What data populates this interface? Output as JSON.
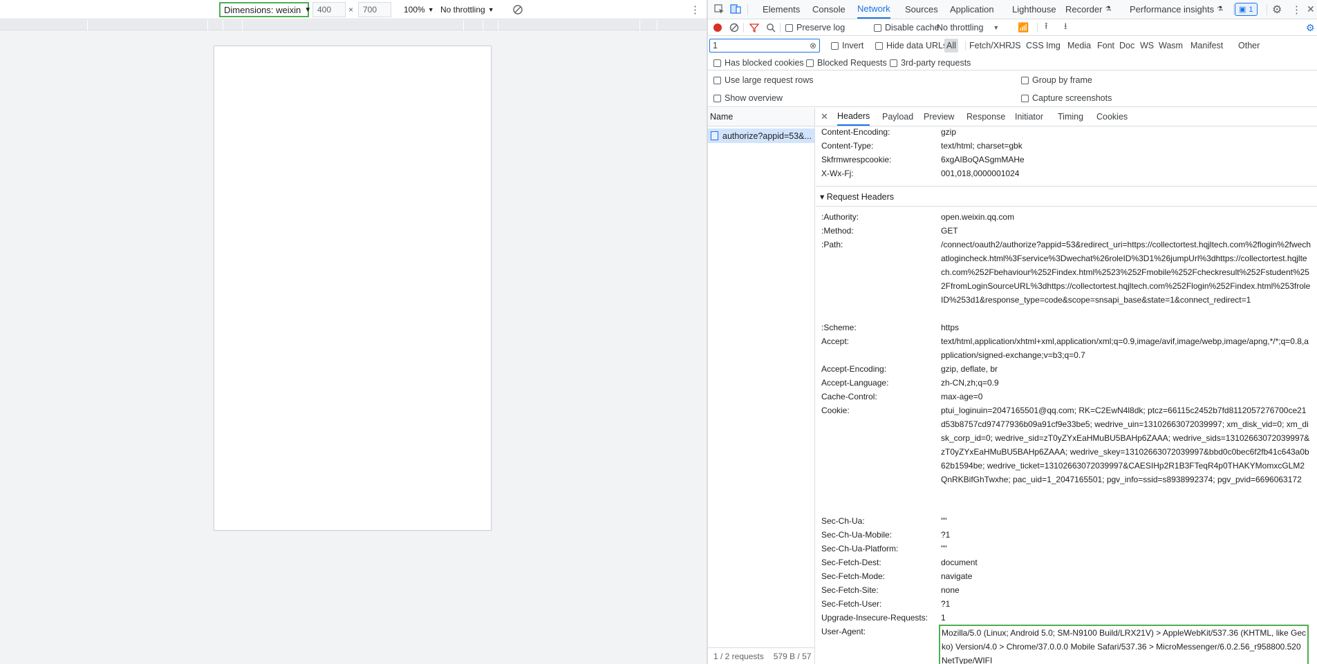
{
  "device_toolbar": {
    "dimensions_label": "Dimensions: weixin",
    "width": "400",
    "times": "×",
    "height": "700",
    "zoom": "100%",
    "throttling": "No throttling"
  },
  "devtools": {
    "tabs": [
      "Elements",
      "Console",
      "Network",
      "Sources",
      "Application",
      "Lighthouse",
      "Recorder",
      "Performance insights"
    ],
    "active_tab": "Network",
    "issues_badge": "1",
    "network_toolbar": {
      "preserve_log": "Preserve log",
      "disable_cache": "Disable cache",
      "throttling": "No throttling"
    },
    "filter": {
      "value": "1",
      "invert": "Invert",
      "hide_data_urls": "Hide data URLs",
      "types": [
        "All",
        "Fetch/XHR",
        "JS",
        "CSS",
        "Img",
        "Media",
        "Font",
        "Doc",
        "WS",
        "Wasm",
        "Manifest",
        "Other"
      ],
      "has_blocked_cookies": "Has blocked cookies",
      "blocked_requests": "Blocked Requests",
      "third_party": "3rd-party requests"
    },
    "settings": {
      "large_rows": "Use large request rows",
      "show_overview": "Show overview",
      "group_by_frame": "Group by frame",
      "capture_screenshots": "Capture screenshots"
    },
    "requests": {
      "name_header": "Name",
      "rows": [
        "authorize?appid=53&..."
      ],
      "status_requests": "1 / 2 requests",
      "status_size": "579 B / 57"
    },
    "detail_tabs": [
      "Headers",
      "Payload",
      "Preview",
      "Response",
      "Initiator",
      "Timing",
      "Cookies"
    ],
    "response_headers": [
      {
        "name": "Content-Encoding:",
        "value": "gzip"
      },
      {
        "name": "Content-Type:",
        "value": "text/html; charset=gbk"
      },
      {
        "name": "Skfrmwrespcookie:",
        "value": "6xgAIBoQASgmMAHe"
      },
      {
        "name": "X-Wx-Fj:",
        "value": "001,018,0000001024"
      }
    ],
    "request_headers_title": "▾ Request Headers",
    "request_headers": [
      {
        "name": ":Authority:",
        "value": "open.weixin.qq.com"
      },
      {
        "name": ":Method:",
        "value": "GET"
      },
      {
        "name": ":Path:",
        "value": "/connect/oauth2/authorize?appid=53&redirect_uri=https://collectortest.hqjltech.com%2flogin%2fwechatlogincheck.html%3Fservice%3Dwechat%26roleID%3D1%26jumpUrl%3dhttps://collectortest.hqjltech.com%252Fbehaviour%252Findex.html%2523%252Fmobile%252Fcheckresult%252Fstudent%252FfromLoginSourceURL%3dhttps://collectortest.hqjltech.com%252Flogin%252Findex.html%253froleID%253d1&response_type=code&scope=snsapi_base&state=1&connect_redirect=1"
      },
      {
        "name": ":Scheme:",
        "value": "https"
      },
      {
        "name": "Accept:",
        "value": "text/html,application/xhtml+xml,application/xml;q=0.9,image/avif,image/webp,image/apng,*/*;q=0.8,application/signed-exchange;v=b3;q=0.7"
      },
      {
        "name": "Accept-Encoding:",
        "value": "gzip, deflate, br"
      },
      {
        "name": "Accept-Language:",
        "value": "zh-CN,zh;q=0.9"
      },
      {
        "name": "Cache-Control:",
        "value": "max-age=0"
      },
      {
        "name": "Cookie:",
        "value": "ptui_loginuin=2047165501@qq.com; RK=C2EwN4l8dk; ptcz=66115c2452b7fd8112057276700ce21d53b8757cd97477936b09a91cf9e33be5; wedrive_uin=13102663072039997; xm_disk_vid=0; xm_disk_corp_id=0; wedrive_sid=zT0yZYxEaHMuBU5BAHp6ZAAA; wedrive_sids=13102663072039997&zT0yZYxEaHMuBU5BAHp6ZAAA; wedrive_skey=13102663072039997&bbd0c0bec6f2fb41c643a0b62b1594be; wedrive_ticket=13102663072039997&CAESIHp2R1B3FTeqR4p0THAKYMomxcGLM2QnRKBifGhTwxhe; pac_uid=1_2047165501; pgv_info=ssid=s8938992374; pgv_pvid=6696063172"
      },
      {
        "name": "Sec-Ch-Ua:",
        "value": "\"\""
      },
      {
        "name": "Sec-Ch-Ua-Mobile:",
        "value": "?1"
      },
      {
        "name": "Sec-Ch-Ua-Platform:",
        "value": "\"\""
      },
      {
        "name": "Sec-Fetch-Dest:",
        "value": "document"
      },
      {
        "name": "Sec-Fetch-Mode:",
        "value": "navigate"
      },
      {
        "name": "Sec-Fetch-Site:",
        "value": "none"
      },
      {
        "name": "Sec-Fetch-User:",
        "value": "?1"
      },
      {
        "name": "Upgrade-Insecure-Requests:",
        "value": "1"
      },
      {
        "name": "User-Agent:",
        "value": "Mozilla/5.0 (Linux; Android 5.0; SM-N9100 Build/LRX21V) > AppleWebKit/537.36 (KHTML, like Gecko) Version/4.0 > Chrome/37.0.0.0 Mobile Safari/537.36 > MicroMessenger/6.0.2.56_r958800.520 NetType/WIFI"
      }
    ],
    "accent_color": "#1a73e8",
    "highlight_color": "#4caf50"
  }
}
